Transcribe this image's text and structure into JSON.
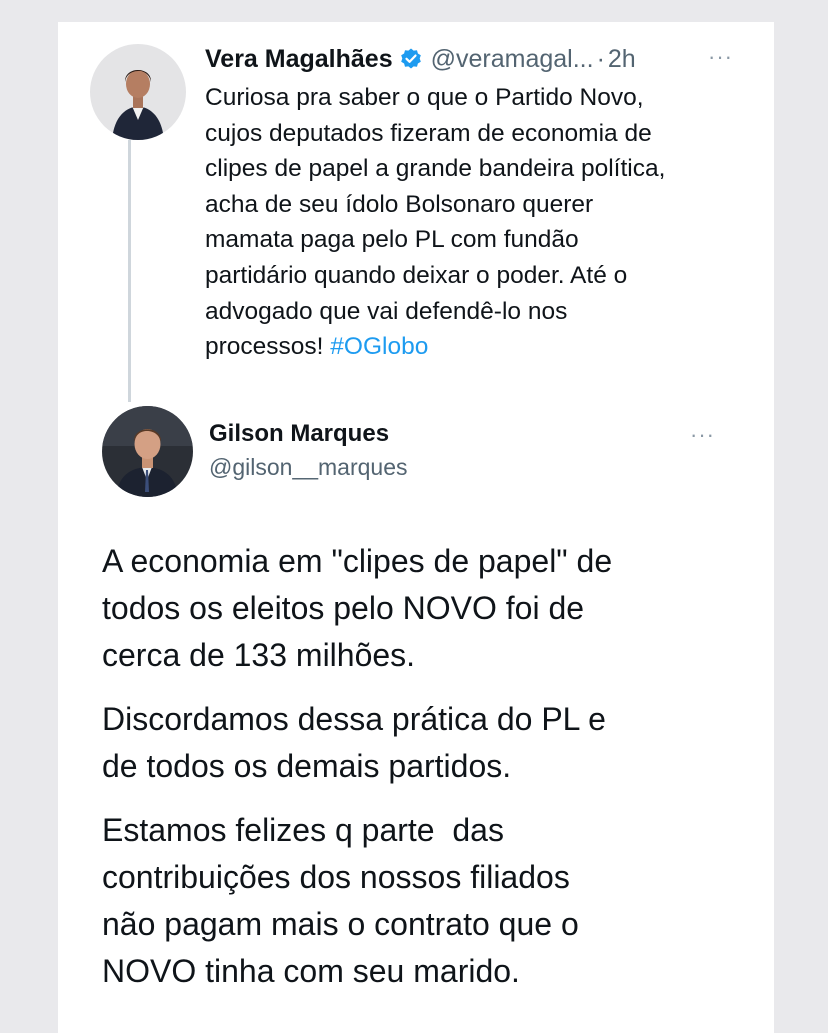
{
  "tweet_original": {
    "author_name": "Vera Magalhães",
    "handle": "@veramagal...",
    "separator": "·",
    "time": "2h",
    "more": "···",
    "text_lines": [
      "Curiosa pra saber o que o Partido Novo,",
      "cujos deputados fizeram de economia de",
      "clipes de papel a grande bandeira política,",
      "acha de seu ídolo Bolsonaro querer",
      "mamata paga pelo PL com fundão",
      "partidário quando deixar o poder. Até o",
      "advogado que vai defendê-lo nos"
    ],
    "last_line_text": "processos! ",
    "hashtag": "#OGlobo"
  },
  "tweet_reply": {
    "author_name": "Gilson Marques",
    "handle": "@gilson__marques",
    "more": "···",
    "paragraphs": [
      [
        "A economia em \"clipes de papel\" de",
        "todos os eleitos pelo NOVO foi de",
        "cerca de 133 milhões."
      ],
      [
        "Discordamos dessa prática do PL e",
        "de todos os demais partidos."
      ],
      [
        "Estamos felizes q parte  das",
        "contribuições dos nossos filiados",
        "não pagam mais o contrato que o",
        "NOVO tinha com seu marido."
      ]
    ]
  },
  "colors": {
    "text": "#0f1419",
    "secondary": "#536471",
    "link": "#1d9bf0",
    "verified": "#1d9bf0"
  },
  "icons": {
    "verified": "verified-badge-icon",
    "more": "more-horizontal-icon"
  }
}
